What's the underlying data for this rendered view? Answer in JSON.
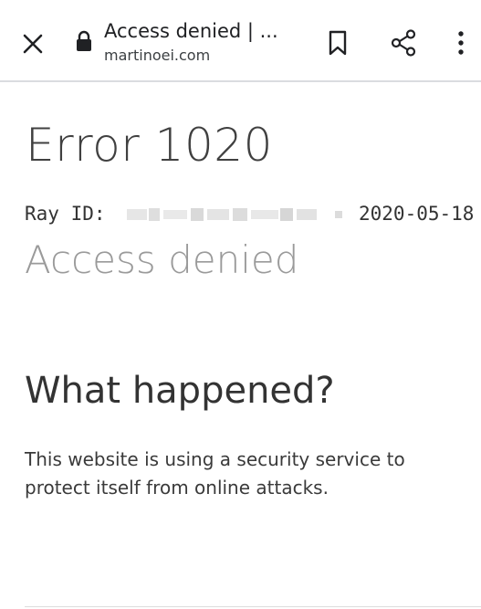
{
  "browser": {
    "tab_title": "Access denied | ...",
    "url": "martinoei.com",
    "icons": {
      "close": "close-icon",
      "lock": "lock-icon",
      "bookmark": "bookmark-icon",
      "share": "share-icon",
      "more": "more-vert-icon"
    }
  },
  "page": {
    "error_title": "Error 1020",
    "ray_label": "Ray ID:",
    "ray_date": "2020-05-18",
    "subtitle": "Access denied",
    "section_heading": "What happened?",
    "explanation": "This website is using a security service to protect itself from online attacks."
  },
  "colors": {
    "title": "#404040",
    "subtitle": "#9a9a9a",
    "body_text": "#333333",
    "divider": "#dadce0"
  }
}
